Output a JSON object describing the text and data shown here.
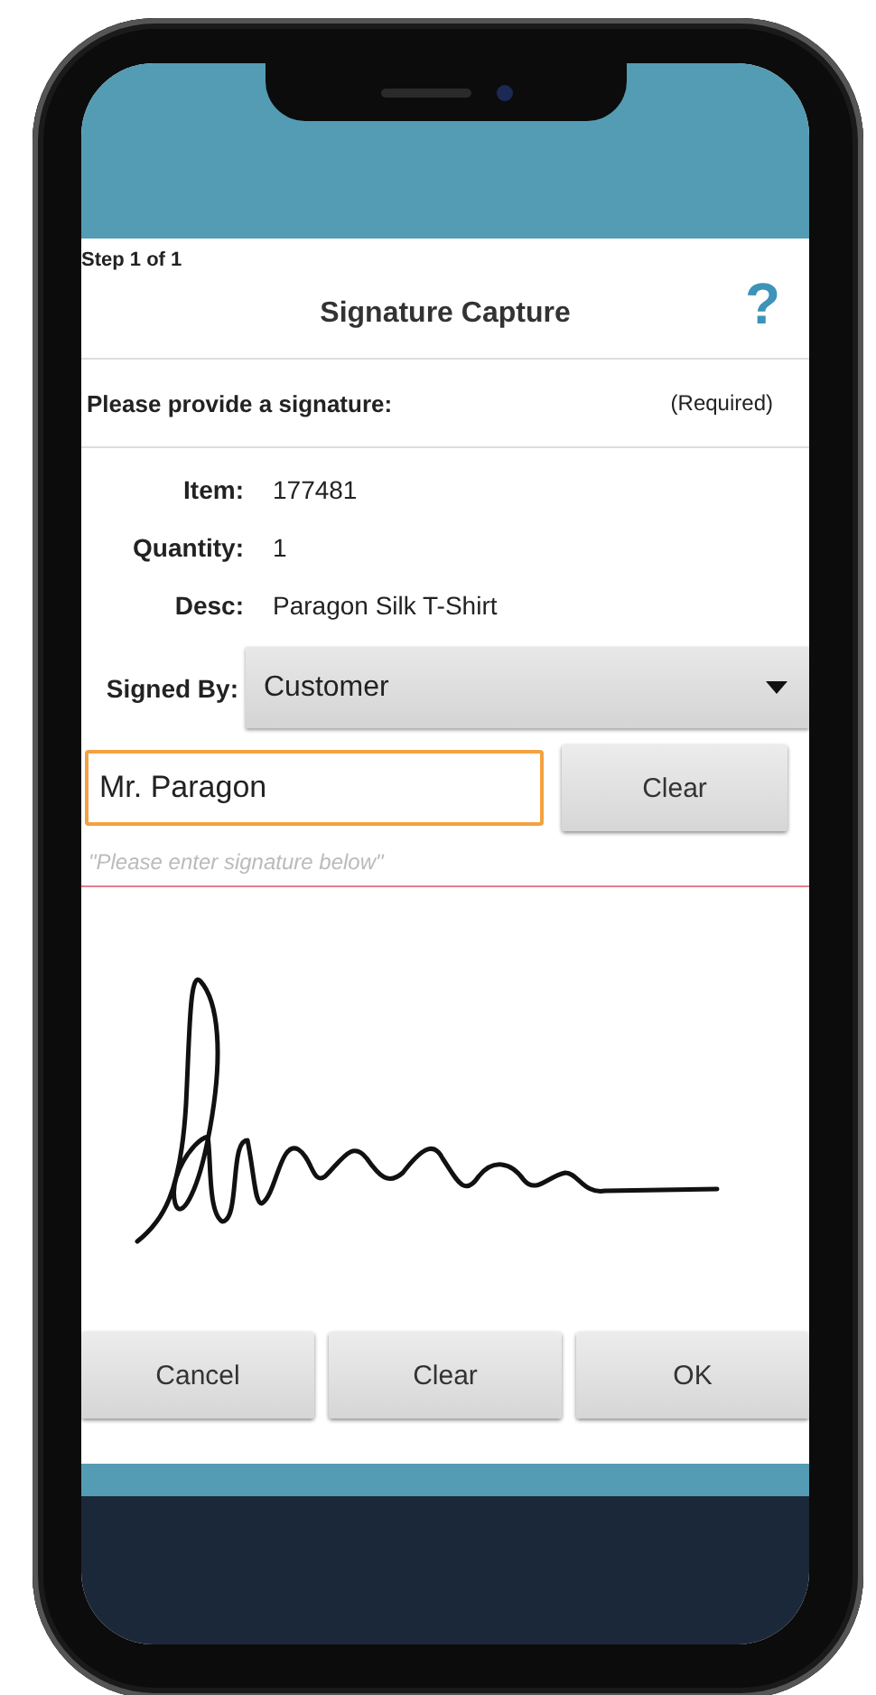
{
  "header": {
    "step": "Step 1 of 1",
    "title": "Signature Capture",
    "help": "?"
  },
  "prompt": {
    "text": "Please provide a signature:",
    "note": "(Required)"
  },
  "details": [
    {
      "label": "Item:",
      "value": "177481"
    },
    {
      "label": "Quantity:",
      "value": "1"
    },
    {
      "label": "Desc:",
      "value": "Paragon Silk T-Shirt"
    }
  ],
  "signed_by": {
    "label": "Signed By:",
    "value": "Customer"
  },
  "name_field": {
    "value": "Mr. Paragon",
    "focused": true
  },
  "name_clear": "Clear",
  "signature_hint": "\"Please enter signature below\"",
  "buttons": [
    "Cancel",
    "Clear",
    "OK"
  ]
}
